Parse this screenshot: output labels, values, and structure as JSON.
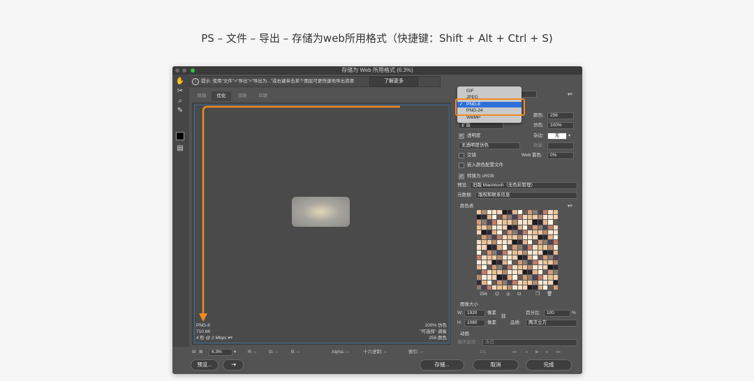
{
  "caption": "PS – 文件 – 导出 – 存储为web所用格式（快捷键：Shift + Alt + Ctrl + S)",
  "window": {
    "title": "存储为 Web 所用格式 (6.3%)",
    "hint": "提示: 使用\"文件\">\"导出\">\"导出为...\"或右键单击某个图层可更快速地导出资源",
    "learn_more": "了解更多"
  },
  "tabs": [
    "原稿",
    "优化",
    "双联",
    "四联"
  ],
  "preview_info": {
    "format": "PNG-8",
    "size": "710.6K",
    "time": "4 秒 @ 2 Mbps",
    "dither": "100% 仿色",
    "palette": "\"可选择\" 调板",
    "colors": "256 颜色"
  },
  "statusbar": {
    "zoom": "6.3%",
    "r": "R: --",
    "g": "G: --",
    "b": "B: --",
    "alpha": "Alpha: --",
    "hex": "十六进制: --",
    "index": "索引: --"
  },
  "buttons": {
    "preview": "预览...",
    "save": "存储...",
    "cancel": "取消",
    "done": "完成"
  },
  "format_dropdown": {
    "items": [
      "GIF",
      "JPEG",
      "PNG-8",
      "PNG-24",
      "WBMP"
    ],
    "selected": "PNG-8"
  },
  "settings": {
    "reduction": "扩散",
    "colors_label": "颜色:",
    "colors_value": "256",
    "dither_label": "仿色:",
    "dither_value": "100%",
    "transparency_label": "透明度",
    "matte_label": "杂边:",
    "matte_value": "无",
    "transparency_dither": "无透明度仿色",
    "amount_label": "数量:",
    "interlaced_label": "交错",
    "web_snap_label": "Web 靠色:",
    "web_snap_value": "0%",
    "embed_profile_label": "嵌入颜色配置文件",
    "convert_srgb_label": "转换为 sRGB",
    "preview_label": "预览:",
    "preview_value": "旧版 Macintosh（无色彩管理）",
    "metadata_label": "元数据:",
    "metadata_value": "版权和联系信息",
    "color_table_label": "颜色表",
    "color_count": "256"
  },
  "image_size": {
    "label": "图像大小",
    "w_label": "W:",
    "w_value": "1920",
    "h_label": "H:",
    "h_value": "1080",
    "unit": "像素",
    "percent_label": "百分比:",
    "percent_value": "100",
    "percent_unit": "%",
    "quality_label": "品质:",
    "quality_value": "两次立方"
  },
  "animation": {
    "label": "动画",
    "loop_label": "循环选项:",
    "loop_value": "永远",
    "frame_counter": "1/1"
  },
  "colors": {
    "accent_orange": "#f08a24",
    "selection_blue": "#2f6fd9",
    "frame_blue": "#3a6ea5",
    "window_bg": "#535353"
  },
  "color_table_palette": [
    "#f2c7a4",
    "#e8b48b",
    "#f6dcc3",
    "#1c1b1e",
    "#4a4453",
    "#f8e5cc",
    "#d79a78",
    "#b48c6c",
    "#fff7e6",
    "#e6c48f",
    "#2f2a35",
    "#c27c66",
    "#f5d3b8",
    "#8a7d70",
    "#fbe9d6",
    "#665a52"
  ]
}
